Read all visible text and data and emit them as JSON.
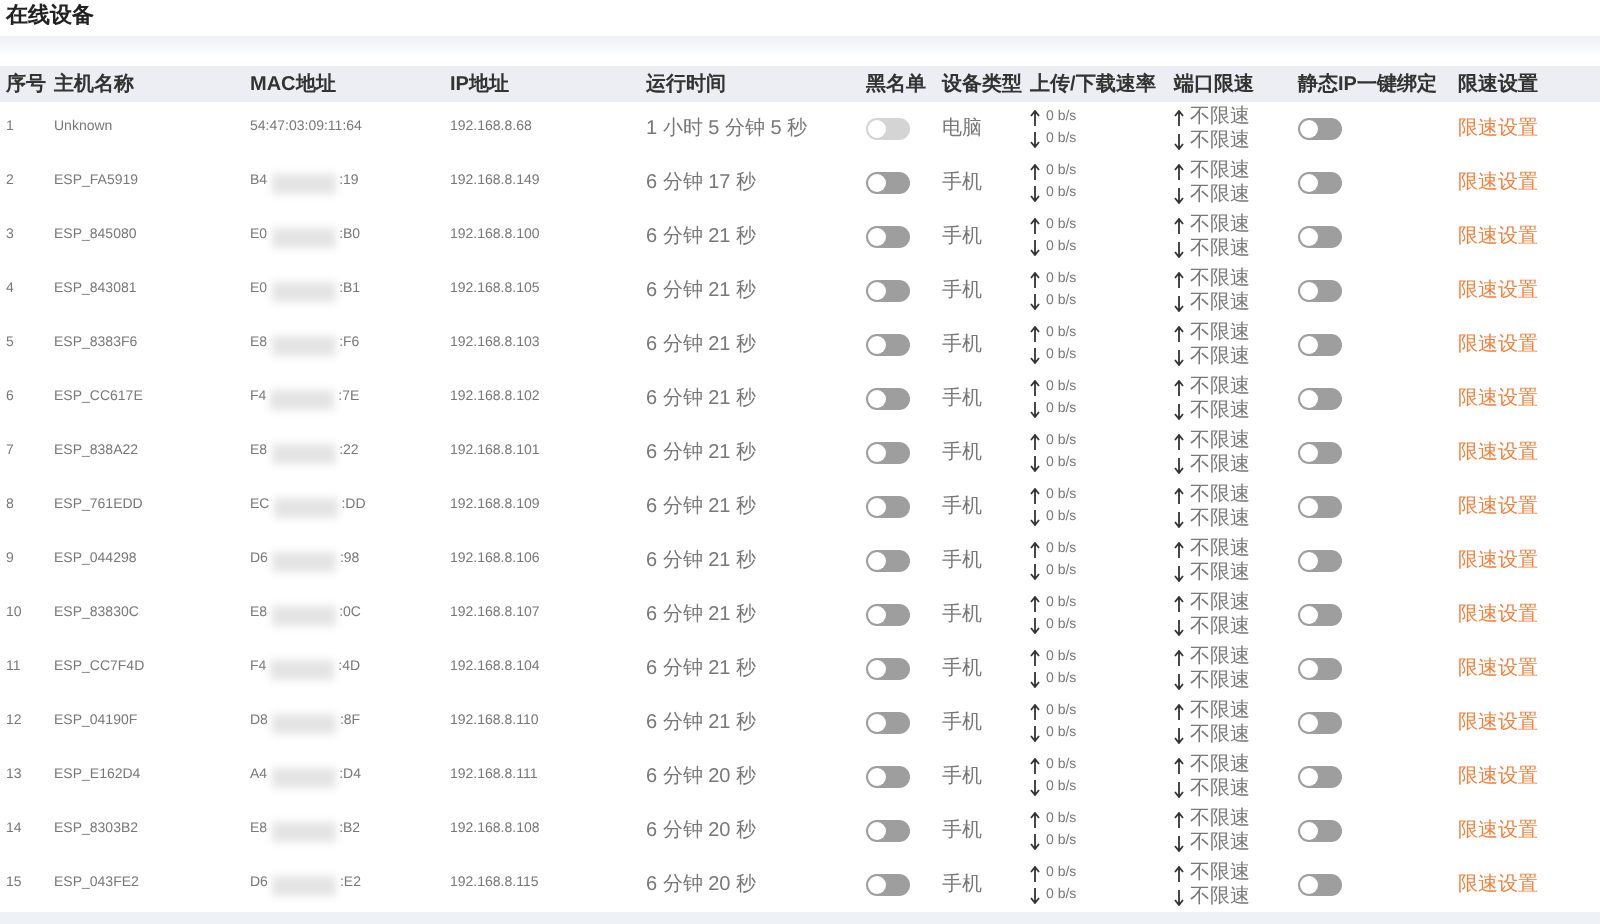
{
  "title": "在线设备",
  "table": {
    "columns": [
      "序号",
      "主机名称",
      "MAC地址",
      "IP地址",
      "运行时间",
      "黑名单",
      "设备类型",
      "上传/下载速率",
      "端口限速",
      "静态IP一键绑定",
      "限速设置"
    ],
    "rows": [
      {
        "index": "1",
        "hostname": "Unknown",
        "mac_parts": [
          "54:47:03:09:11:64"
        ],
        "ip": "192.168.8.68",
        "uptime": "1 小时 5 分钟 5 秒",
        "blacklist": {
          "on": false,
          "disabled": true
        },
        "device_type": "电脑",
        "upload": "0 b/s",
        "download": "0 b/s",
        "upload_limit": "不限速",
        "download_limit": "不限速",
        "static_ip": {
          "on": false
        },
        "action": "限速设置"
      },
      {
        "index": "2",
        "hostname": "ESP_FA5919",
        "mac_parts": [
          "B4",
          ":19"
        ],
        "ip": "192.168.8.149",
        "uptime": "6 分钟 17 秒",
        "blacklist": {
          "on": false,
          "disabled": false
        },
        "device_type": "手机",
        "upload": "0 b/s",
        "download": "0 b/s",
        "upload_limit": "不限速",
        "download_limit": "不限速",
        "static_ip": {
          "on": false
        },
        "action": "限速设置"
      },
      {
        "index": "3",
        "hostname": "ESP_845080",
        "mac_parts": [
          "E0",
          ":B0"
        ],
        "ip": "192.168.8.100",
        "uptime": "6 分钟 21 秒",
        "blacklist": {
          "on": false,
          "disabled": false
        },
        "device_type": "手机",
        "upload": "0 b/s",
        "download": "0 b/s",
        "upload_limit": "不限速",
        "download_limit": "不限速",
        "static_ip": {
          "on": false
        },
        "action": "限速设置"
      },
      {
        "index": "4",
        "hostname": "ESP_843081",
        "mac_parts": [
          "E0",
          ":B1"
        ],
        "ip": "192.168.8.105",
        "uptime": "6 分钟 21 秒",
        "blacklist": {
          "on": false,
          "disabled": false
        },
        "device_type": "手机",
        "upload": "0 b/s",
        "download": "0 b/s",
        "upload_limit": "不限速",
        "download_limit": "不限速",
        "static_ip": {
          "on": false
        },
        "action": "限速设置"
      },
      {
        "index": "5",
        "hostname": "ESP_8383F6",
        "mac_parts": [
          "E8",
          ":F6"
        ],
        "ip": "192.168.8.103",
        "uptime": "6 分钟 21 秒",
        "blacklist": {
          "on": false,
          "disabled": false
        },
        "device_type": "手机",
        "upload": "0 b/s",
        "download": "0 b/s",
        "upload_limit": "不限速",
        "download_limit": "不限速",
        "static_ip": {
          "on": false
        },
        "action": "限速设置"
      },
      {
        "index": "6",
        "hostname": "ESP_CC617E",
        "mac_parts": [
          "F4",
          ":7E"
        ],
        "ip": "192.168.8.102",
        "uptime": "6 分钟 21 秒",
        "blacklist": {
          "on": false,
          "disabled": false
        },
        "device_type": "手机",
        "upload": "0 b/s",
        "download": "0 b/s",
        "upload_limit": "不限速",
        "download_limit": "不限速",
        "static_ip": {
          "on": false
        },
        "action": "限速设置"
      },
      {
        "index": "7",
        "hostname": "ESP_838A22",
        "mac_parts": [
          "E8",
          ":22"
        ],
        "ip": "192.168.8.101",
        "uptime": "6 分钟 21 秒",
        "blacklist": {
          "on": false,
          "disabled": false
        },
        "device_type": "手机",
        "upload": "0 b/s",
        "download": "0 b/s",
        "upload_limit": "不限速",
        "download_limit": "不限速",
        "static_ip": {
          "on": false
        },
        "action": "限速设置"
      },
      {
        "index": "8",
        "hostname": "ESP_761EDD",
        "mac_parts": [
          "EC",
          ":DD"
        ],
        "ip": "192.168.8.109",
        "uptime": "6 分钟 21 秒",
        "blacklist": {
          "on": false,
          "disabled": false
        },
        "device_type": "手机",
        "upload": "0 b/s",
        "download": "0 b/s",
        "upload_limit": "不限速",
        "download_limit": "不限速",
        "static_ip": {
          "on": false
        },
        "action": "限速设置"
      },
      {
        "index": "9",
        "hostname": "ESP_044298",
        "mac_parts": [
          "D6",
          ":98"
        ],
        "ip": "192.168.8.106",
        "uptime": "6 分钟 21 秒",
        "blacklist": {
          "on": false,
          "disabled": false
        },
        "device_type": "手机",
        "upload": "0 b/s",
        "download": "0 b/s",
        "upload_limit": "不限速",
        "download_limit": "不限速",
        "static_ip": {
          "on": false
        },
        "action": "限速设置"
      },
      {
        "index": "10",
        "hostname": "ESP_83830C",
        "mac_parts": [
          "E8",
          ":0C"
        ],
        "ip": "192.168.8.107",
        "uptime": "6 分钟 21 秒",
        "blacklist": {
          "on": false,
          "disabled": false
        },
        "device_type": "手机",
        "upload": "0 b/s",
        "download": "0 b/s",
        "upload_limit": "不限速",
        "download_limit": "不限速",
        "static_ip": {
          "on": false
        },
        "action": "限速设置"
      },
      {
        "index": "11",
        "hostname": "ESP_CC7F4D",
        "mac_parts": [
          "F4",
          ":4D"
        ],
        "ip": "192.168.8.104",
        "uptime": "6 分钟 21 秒",
        "blacklist": {
          "on": false,
          "disabled": false
        },
        "device_type": "手机",
        "upload": "0 b/s",
        "download": "0 b/s",
        "upload_limit": "不限速",
        "download_limit": "不限速",
        "static_ip": {
          "on": false
        },
        "action": "限速设置"
      },
      {
        "index": "12",
        "hostname": "ESP_04190F",
        "mac_parts": [
          "D8",
          ":8F"
        ],
        "ip": "192.168.8.110",
        "uptime": "6 分钟 21 秒",
        "blacklist": {
          "on": false,
          "disabled": false
        },
        "device_type": "手机",
        "upload": "0 b/s",
        "download": "0 b/s",
        "upload_limit": "不限速",
        "download_limit": "不限速",
        "static_ip": {
          "on": false
        },
        "action": "限速设置"
      },
      {
        "index": "13",
        "hostname": "ESP_E162D4",
        "mac_parts": [
          "A4",
          ":D4"
        ],
        "ip": "192.168.8.111",
        "uptime": "6 分钟 20 秒",
        "blacklist": {
          "on": false,
          "disabled": false
        },
        "device_type": "手机",
        "upload": "0 b/s",
        "download": "0 b/s",
        "upload_limit": "不限速",
        "download_limit": "不限速",
        "static_ip": {
          "on": false
        },
        "action": "限速设置"
      },
      {
        "index": "14",
        "hostname": "ESP_8303B2",
        "mac_parts": [
          "E8",
          ":B2"
        ],
        "ip": "192.168.8.108",
        "uptime": "6 分钟 20 秒",
        "blacklist": {
          "on": false,
          "disabled": false
        },
        "device_type": "手机",
        "upload": "0 b/s",
        "download": "0 b/s",
        "upload_limit": "不限速",
        "download_limit": "不限速",
        "static_ip": {
          "on": false
        },
        "action": "限速设置"
      },
      {
        "index": "15",
        "hostname": "ESP_043FE2",
        "mac_parts": [
          "D6",
          ":E2"
        ],
        "ip": "192.168.8.115",
        "uptime": "6 分钟 20 秒",
        "blacklist": {
          "on": false,
          "disabled": false
        },
        "device_type": "手机",
        "upload": "0 b/s",
        "download": "0 b/s",
        "upload_limit": "不限速",
        "download_limit": "不限速",
        "static_ip": {
          "on": false
        },
        "action": "限速设置"
      }
    ]
  }
}
